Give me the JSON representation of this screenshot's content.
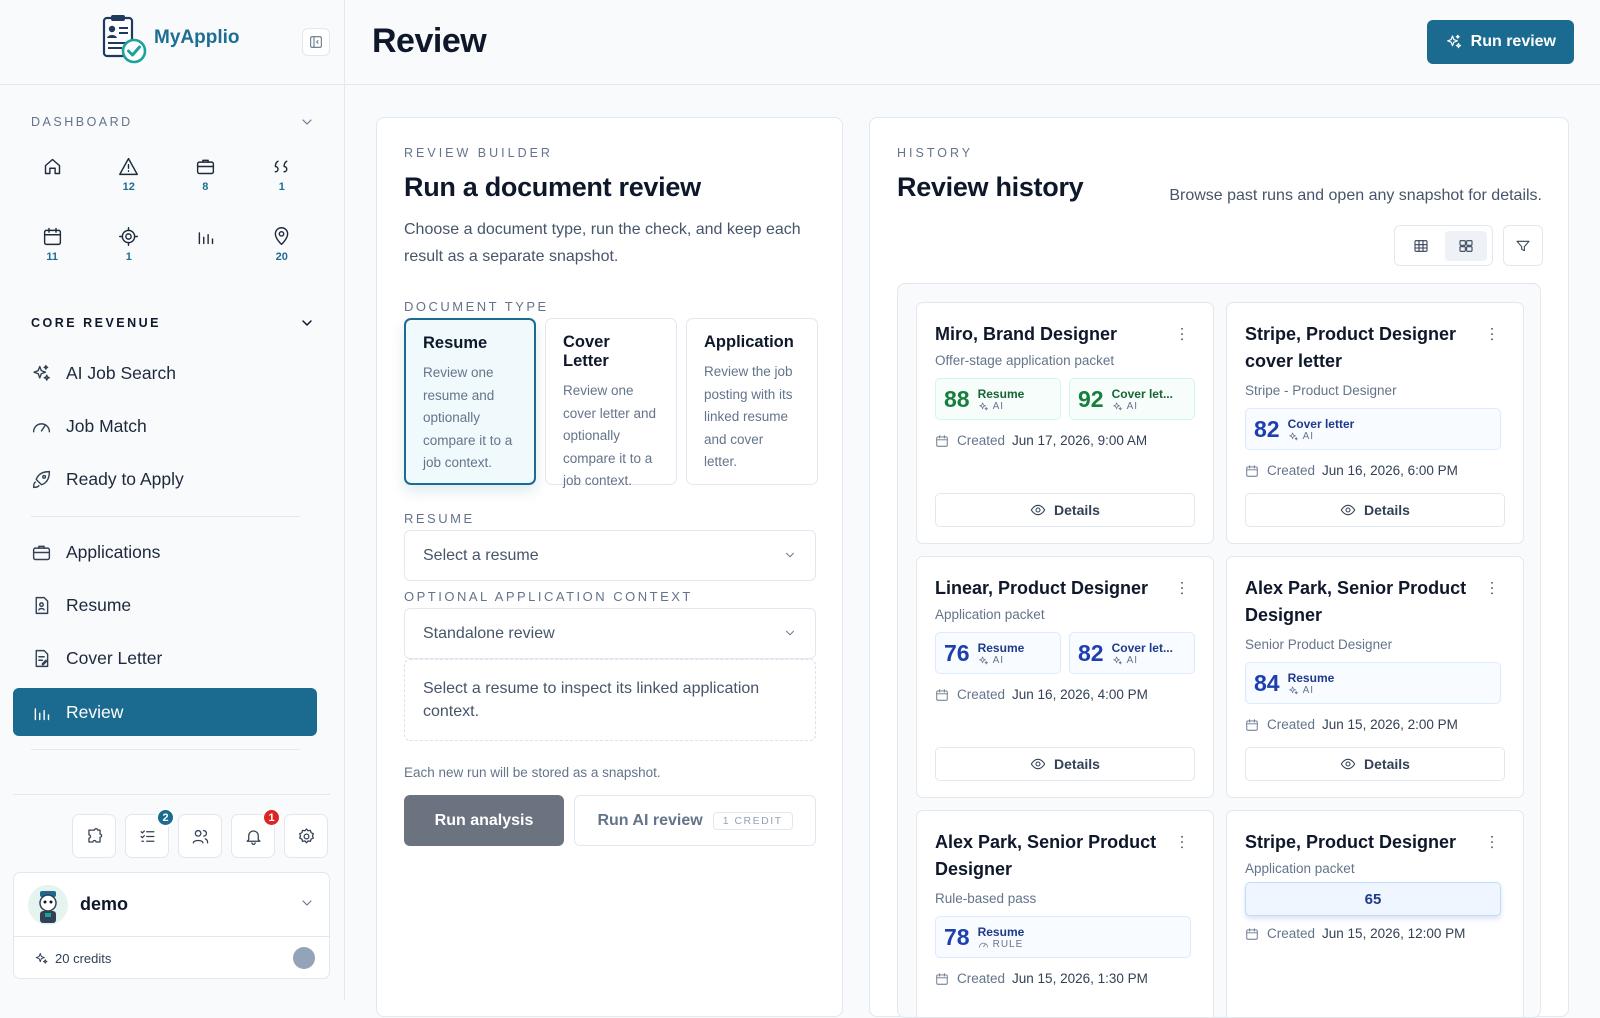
{
  "app": {
    "name": "MyApplio"
  },
  "sidebar": {
    "dashboard_label": "DASHBOARD",
    "quick": [
      {
        "icon": "home-icon",
        "count": ""
      },
      {
        "icon": "alert-icon",
        "count": "12"
      },
      {
        "icon": "briefcase-icon",
        "count": "8"
      },
      {
        "icon": "quote-icon",
        "count": "1"
      },
      {
        "icon": "calendar-icon",
        "count": "11"
      },
      {
        "icon": "target-icon",
        "count": "1"
      },
      {
        "icon": "bar-chart-icon",
        "count": ""
      },
      {
        "icon": "map-pin-icon",
        "count": "20"
      }
    ],
    "core_label": "CORE REVENUE",
    "nav": [
      {
        "label": "AI Job Search",
        "icon": "sparkles-icon"
      },
      {
        "label": "Job Match",
        "icon": "gauge-icon"
      },
      {
        "label": "Ready to Apply",
        "icon": "rocket-icon"
      },
      {
        "label": "Applications",
        "icon": "briefcase-icon"
      },
      {
        "label": "Resume",
        "icon": "resume-icon"
      },
      {
        "label": "Cover Letter",
        "icon": "cover-letter-icon"
      },
      {
        "label": "Review",
        "icon": "bar-chart-icon",
        "active": true
      }
    ],
    "utility": {
      "tasks_badge": "2",
      "notifications_badge": "1"
    },
    "user": {
      "name": "demo",
      "credits": "20 credits"
    }
  },
  "header": {
    "title": "Review",
    "run_review": "Run review"
  },
  "builder": {
    "eyebrow": "REVIEW BUILDER",
    "title": "Run a document review",
    "description": "Choose a document type, run the check, and keep each result as a separate snapshot.",
    "doc_type_label": "DOCUMENT TYPE",
    "doc_types": [
      {
        "title": "Resume",
        "desc": "Review one resume and optionally compare it to a job context."
      },
      {
        "title": "Cover Letter",
        "desc": "Review one cover letter and optionally compare it to a job context."
      },
      {
        "title": "Application",
        "desc": "Review the job posting with its linked resume and cover letter."
      }
    ],
    "resume_label": "RESUME",
    "resume_value": "Select a resume",
    "context_label": "OPTIONAL APPLICATION CONTEXT",
    "context_value": "Standalone review",
    "context_hint": "Select a resume to inspect its linked application context.",
    "snapshot_note": "Each new run will be stored as a snapshot.",
    "run_analysis": "Run analysis",
    "run_ai": "Run AI review",
    "credit_pill": "1 CREDIT"
  },
  "history": {
    "eyebrow": "HISTORY",
    "title": "Review history",
    "subtitle": "Browse past runs and open any snapshot for details.",
    "created_label": "Created",
    "details_label": "Details",
    "cards": [
      {
        "title": "Miro, Brand Designer",
        "subtitle": "Offer-stage application packet",
        "scores": [
          {
            "value": "88",
            "label": "Resume",
            "source": "AI",
            "tone": "green"
          },
          {
            "value": "92",
            "label": "Cover let...",
            "source": "AI",
            "tone": "green"
          }
        ],
        "created": "Jun 17, 2026, 9:00 AM"
      },
      {
        "title": "Stripe, Product Designer cover letter",
        "subtitle": "Stripe - Product Designer",
        "scores": [
          {
            "value": "82",
            "label": "Cover letter",
            "source": "AI",
            "tone": "blue"
          }
        ],
        "created": "Jun 16, 2026, 6:00 PM"
      },
      {
        "title": "Linear, Product Designer",
        "subtitle": "Application packet",
        "scores": [
          {
            "value": "76",
            "label": "Resume",
            "source": "AI",
            "tone": "blue"
          },
          {
            "value": "82",
            "label": "Cover let...",
            "source": "AI",
            "tone": "blue"
          }
        ],
        "created": "Jun 16, 2026, 4:00 PM"
      },
      {
        "title": "Alex Park, Senior Product Designer",
        "subtitle": "Senior Product Designer",
        "scores": [
          {
            "value": "84",
            "label": "Resume",
            "source": "AI",
            "tone": "blue"
          }
        ],
        "created": "Jun 15, 2026, 2:00 PM"
      },
      {
        "title": "Alex Park, Senior Product Designer",
        "subtitle": "Rule-based pass",
        "scores": [
          {
            "value": "78",
            "label": "Resume",
            "source": "RULE",
            "tone": "blue"
          }
        ],
        "created": "Jun 15, 2026, 1:30 PM"
      },
      {
        "title": "Stripe, Product Designer",
        "subtitle": "Application packet",
        "scores": [
          {
            "value": "65",
            "label": "",
            "source": "",
            "tone": "center"
          }
        ],
        "created": "Jun 15, 2026, 12:00 PM"
      }
    ]
  },
  "colors": {
    "accent": "#1b6a8f",
    "score_green": "#15803d",
    "score_blue": "#1e40af",
    "badge_red": "#dc2626"
  }
}
